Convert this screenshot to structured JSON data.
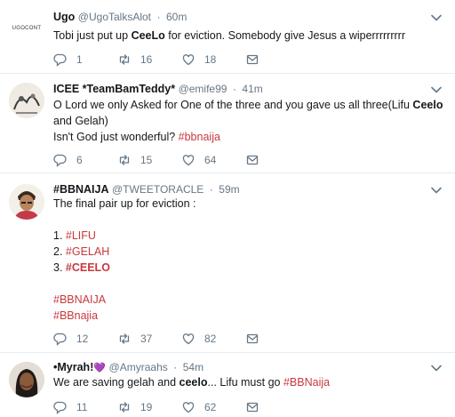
{
  "tweets": [
    {
      "name": "Ugo",
      "handle": "@UgoTalksAlot",
      "time": "60m",
      "avatar_text": "UGOCONT",
      "text_a": "Tobi just put up ",
      "text_b": "CeeLo",
      "text_c": " for eviction. Somebody give Jesus a wiperrrrrrrrr",
      "replies": "1",
      "retweets": "16",
      "likes": "18"
    },
    {
      "name": "ICEE *TeamBamTeddy*",
      "handle": "@emife99",
      "time": "41m",
      "line1a": "O Lord we only Asked for One of the three and you gave us all three(Lifu ",
      "line1b": "Ceelo",
      "line2": "and Gelah)",
      "line3a": "Isn't God just wonderful? ",
      "line3b": "#bbnaija",
      "replies": "6",
      "retweets": "15",
      "likes": "64"
    },
    {
      "name": "#BBNAIJA",
      "handle": "@TWEETORACLE",
      "time": "59m",
      "intro": "The final pair up for eviction :",
      "list": [
        {
          "num": "1. ",
          "tag": "#LIFU"
        },
        {
          "num": "2. ",
          "tag": "#GELAH"
        },
        {
          "num": "3. ",
          "tag": "#CEELO"
        }
      ],
      "tag1": "#BBNAIJA",
      "tag2": "#BBnajia",
      "replies": "12",
      "retweets": "37",
      "likes": "82"
    },
    {
      "name": "•Myrah!",
      "heart": "💜",
      "handle": "@Amyraahs",
      "time": "54m",
      "text_a": "We are saving gelah and ",
      "text_b": "ceelo",
      "text_c": "... Lifu must go ",
      "text_d": "#BBNaija",
      "replies": "11",
      "retweets": "19",
      "likes": "62"
    }
  ],
  "separator": "·",
  "colors": {
    "hashtag": "#c8383e",
    "muted": "#657786",
    "text": "#14171a",
    "divider": "#e6ecf0",
    "heart": "#9b6bd6"
  },
  "icons": [
    "reply-icon",
    "retweet-icon",
    "like-icon",
    "direct-message-icon",
    "chevron-down-icon"
  ]
}
